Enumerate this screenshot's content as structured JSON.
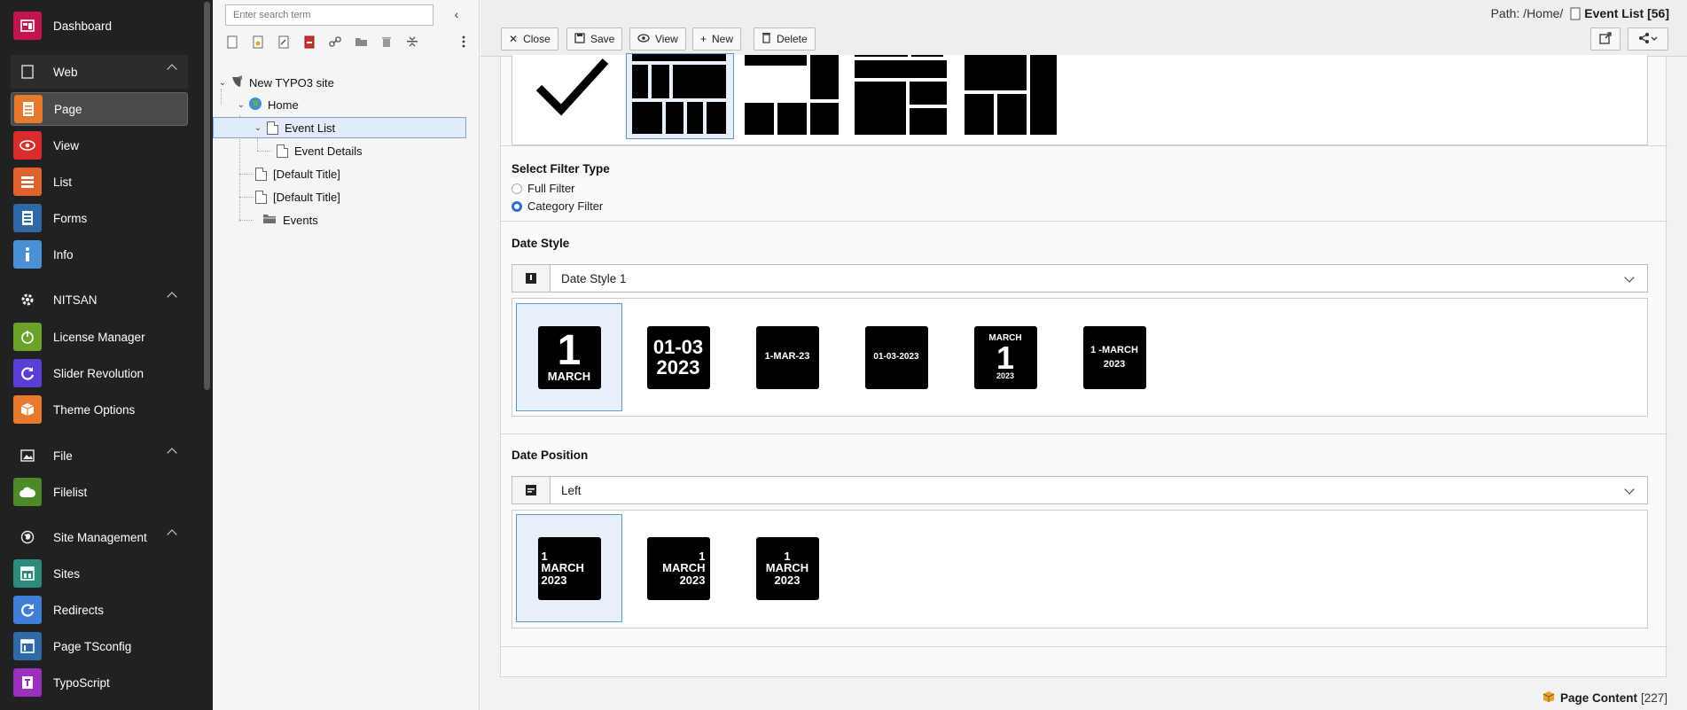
{
  "module_menu": {
    "top": [
      {
        "label": "Dashboard",
        "icon": "dashboard-icon",
        "color": "#c1154e"
      }
    ],
    "groups": [
      {
        "label": "Web",
        "icon": "web-page-icon",
        "items": [
          {
            "label": "Page",
            "icon": "page-module-icon",
            "color": "#e87a30",
            "active": true
          },
          {
            "label": "View",
            "icon": "eye-icon",
            "color": "#d92c2c"
          },
          {
            "label": "List",
            "icon": "list-icon",
            "color": "#e0622c"
          },
          {
            "label": "Forms",
            "icon": "forms-icon",
            "color": "#2f6aa6"
          },
          {
            "label": "Info",
            "icon": "info-icon",
            "color": "#4a90d6"
          }
        ]
      },
      {
        "label": "NITSAN",
        "icon": "gear-icon",
        "items": [
          {
            "label": "License Manager",
            "icon": "power-icon",
            "color": "#6ba22a"
          },
          {
            "label": "Slider Revolution",
            "icon": "refresh-icon",
            "color": "#5a3ed6"
          },
          {
            "label": "Theme Options",
            "icon": "box-icon",
            "color": "#e87a30"
          }
        ]
      },
      {
        "label": "File",
        "icon": "image-icon",
        "items": [
          {
            "label": "Filelist",
            "icon": "cloud-icon",
            "color": "#4b8a27"
          }
        ]
      },
      {
        "label": "Site Management",
        "icon": "globe-icon",
        "items": [
          {
            "label": "Sites",
            "icon": "sites-icon",
            "color": "#2e8a7a"
          },
          {
            "label": "Redirects",
            "icon": "redirect-icon",
            "color": "#3f7fd6"
          },
          {
            "label": "Page TSconfig",
            "icon": "tsconfig-icon",
            "color": "#2f6aa6"
          },
          {
            "label": "TypoScript",
            "icon": "typoscript-icon",
            "color": "#9b2fc0"
          }
        ]
      }
    ]
  },
  "page_tree": {
    "search_placeholder": "Enter search term",
    "nodes": [
      {
        "label": "New TYPO3 site",
        "icon": "typo3-icon"
      },
      {
        "label": "Home",
        "icon": "globe-icon"
      },
      {
        "label": "Event List",
        "icon": "page-icon",
        "selected": true
      },
      {
        "label": "Event Details",
        "icon": "page-icon"
      },
      {
        "label": "[Default Title]",
        "icon": "page-icon"
      },
      {
        "label": "[Default Title]",
        "icon": "page-icon"
      },
      {
        "label": "Events",
        "icon": "folder-icon"
      }
    ]
  },
  "doc_header": {
    "buttons": [
      {
        "label": "Close",
        "icon": "close-icon"
      },
      {
        "label": "Save",
        "icon": "save-icon"
      },
      {
        "label": "View",
        "icon": "eye-icon"
      },
      {
        "label": "New",
        "icon": "plus-icon"
      },
      {
        "label": "Delete",
        "icon": "trash-icon"
      }
    ],
    "path_label": "Path: /Home/",
    "path_title": "Event List [56]"
  },
  "filter_type": {
    "title": "Select Filter Type",
    "options": [
      {
        "label": "Full Filter",
        "checked": false
      },
      {
        "label": "Category Filter",
        "checked": true
      }
    ]
  },
  "date_style": {
    "title": "Date Style",
    "selected": "Date Style 1",
    "tiles": [
      {
        "lines": [
          "1",
          "MARCH"
        ]
      },
      {
        "lines": [
          "01-03",
          "2023"
        ]
      },
      {
        "lines": [
          "1-MAR-23"
        ]
      },
      {
        "lines": [
          "01-03-2023"
        ]
      },
      {
        "lines": [
          "MARCH",
          "1",
          "2023"
        ]
      },
      {
        "lines": [
          "1 -MARCH",
          "2023"
        ]
      }
    ]
  },
  "date_position": {
    "title": "Date Position",
    "selected": "Left",
    "tiles": [
      {
        "lines": [
          "1",
          "MARCH",
          "2023"
        ],
        "align": "left"
      },
      {
        "lines": [
          "1",
          "MARCH",
          "2023"
        ],
        "align": "right"
      },
      {
        "lines": [
          "1",
          "MARCH",
          "2023"
        ],
        "align": "center"
      }
    ]
  },
  "footer": {
    "label": "Page Content",
    "uid": "[227]"
  }
}
